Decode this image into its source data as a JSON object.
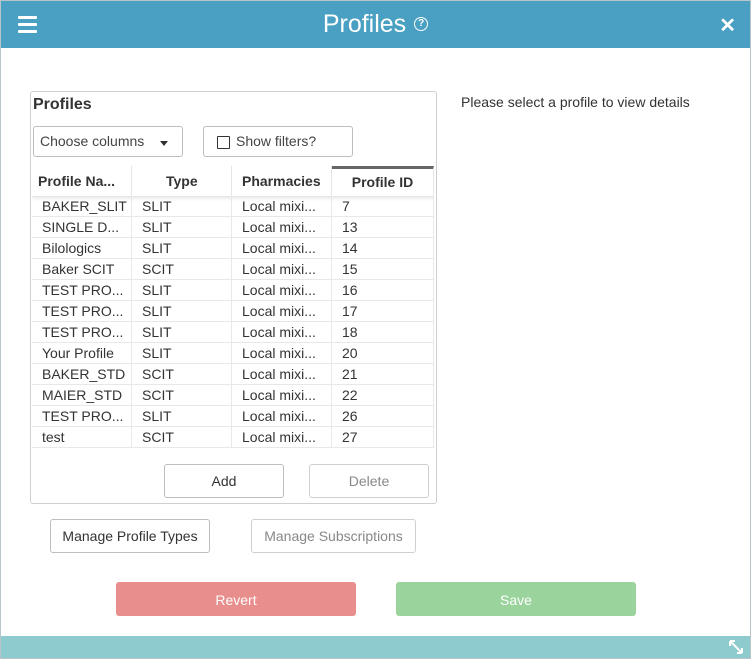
{
  "header": {
    "title": "Profiles",
    "help_icon": "?",
    "close_icon": "✕",
    "menu_icon": "hamburger-icon"
  },
  "panel": {
    "title": "Profiles",
    "choose_columns_label": "Choose columns",
    "show_filters_label": "Show filters?",
    "columns": [
      "Profile Na...",
      "Type",
      "Pharmacies",
      "Profile ID"
    ],
    "rows": [
      [
        "BAKER_SLIT",
        "SLIT",
        "Local mixi...",
        "7"
      ],
      [
        "SINGLE D...",
        "SLIT",
        "Local mixi...",
        "13"
      ],
      [
        "Bilologics",
        "SLIT",
        "Local mixi...",
        "14"
      ],
      [
        "Baker SCIT",
        "SCIT",
        "Local mixi...",
        "15"
      ],
      [
        "TEST PRO...",
        "SLIT",
        "Local mixi...",
        "16"
      ],
      [
        "TEST PRO...",
        "SLIT",
        "Local mixi...",
        "17"
      ],
      [
        "TEST PRO...",
        "SLIT",
        "Local mixi...",
        "18"
      ],
      [
        "Your Profile",
        "SLIT",
        "Local mixi...",
        "20"
      ],
      [
        "BAKER_STD",
        "SCIT",
        "Local mixi...",
        "21"
      ],
      [
        "MAIER_STD",
        "SCIT",
        "Local mixi...",
        "22"
      ],
      [
        "TEST PRO...",
        "SLIT",
        "Local mixi...",
        "26"
      ],
      [
        "test",
        "SCIT",
        "Local mixi...",
        "27"
      ]
    ],
    "add_label": "Add",
    "delete_label": "Delete"
  },
  "details": {
    "placeholder": "Please select a profile to view details"
  },
  "actions": {
    "manage_types_label": "Manage Profile Types",
    "manage_subscriptions_label": "Manage Subscriptions",
    "revert_label": "Revert",
    "save_label": "Save"
  },
  "colors": {
    "header": "#4aa0c2",
    "revert": "#e88e8c",
    "save": "#9ad39b",
    "footer": "#8ecbcf"
  }
}
